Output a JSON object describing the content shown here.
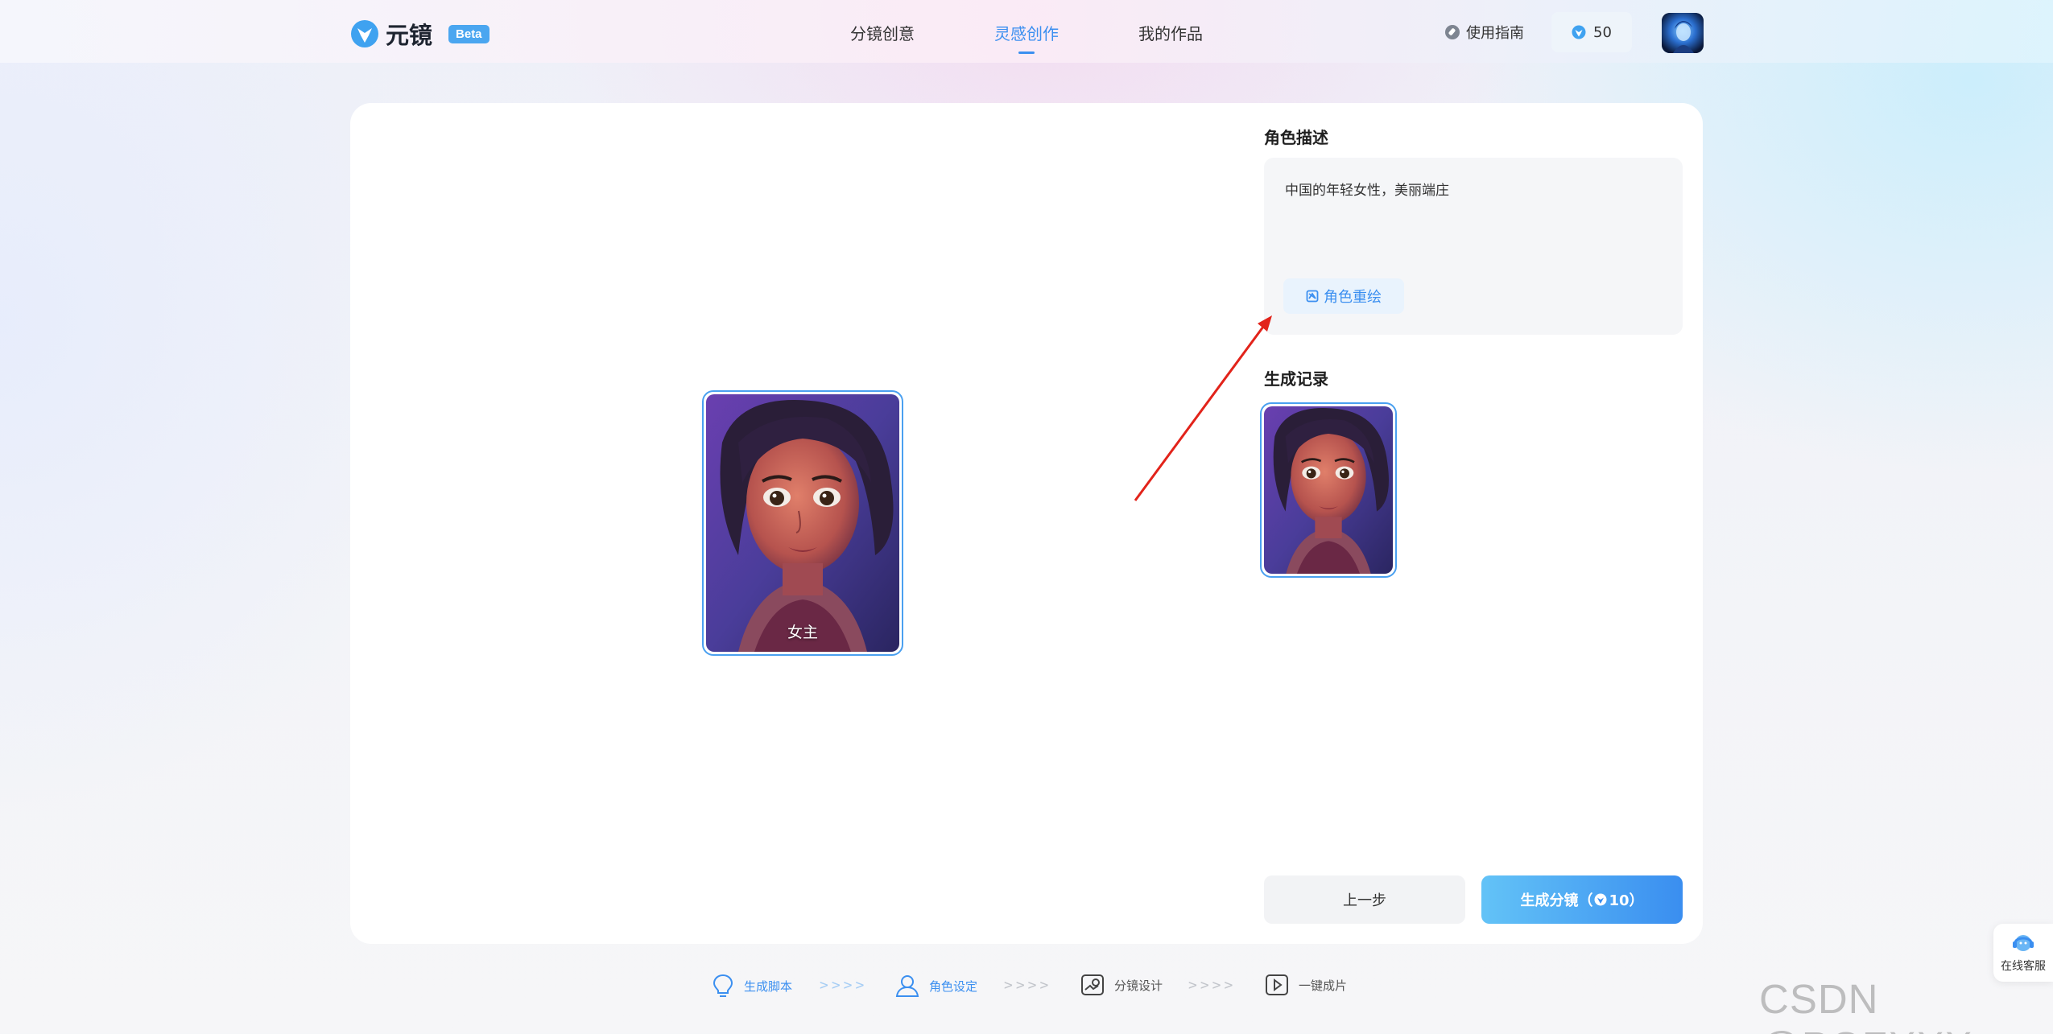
{
  "header": {
    "logo_text": "元镜",
    "beta_badge": "Beta",
    "nav": [
      {
        "label": "分镜创意",
        "active": false
      },
      {
        "label": "灵感创作",
        "active": true
      },
      {
        "label": "我的作品",
        "active": false
      }
    ],
    "guide_label": "使用指南",
    "credits": "50"
  },
  "canvas": {
    "portrait_label": "女主"
  },
  "panel": {
    "desc_title": "角色描述",
    "desc_text": "中国的年轻女性，美丽端庄",
    "redraw_label": "角色重绘",
    "history_title": "生成记录"
  },
  "actions": {
    "prev_label": "上一步",
    "generate_label": "生成分镜（",
    "generate_cost": "10）"
  },
  "steps": [
    {
      "label": "生成脚本",
      "icon": "bulb-icon",
      "active": true
    },
    {
      "label": "角色设定",
      "icon": "user-icon",
      "active": true
    },
    {
      "label": "分镜设计",
      "icon": "storyboard-icon",
      "active": false
    },
    {
      "label": "一键成片",
      "icon": "play-icon",
      "active": false
    }
  ],
  "step_arrows": ">>>>",
  "service": {
    "label": "在线客服"
  },
  "watermark": "CSDN @PGZXXX",
  "colors": {
    "accent": "#3b8ff0",
    "button_gradient_start": "#63c3f7",
    "button_gradient_end": "#3a8ef0",
    "annotation_arrow": "#e2231a"
  }
}
